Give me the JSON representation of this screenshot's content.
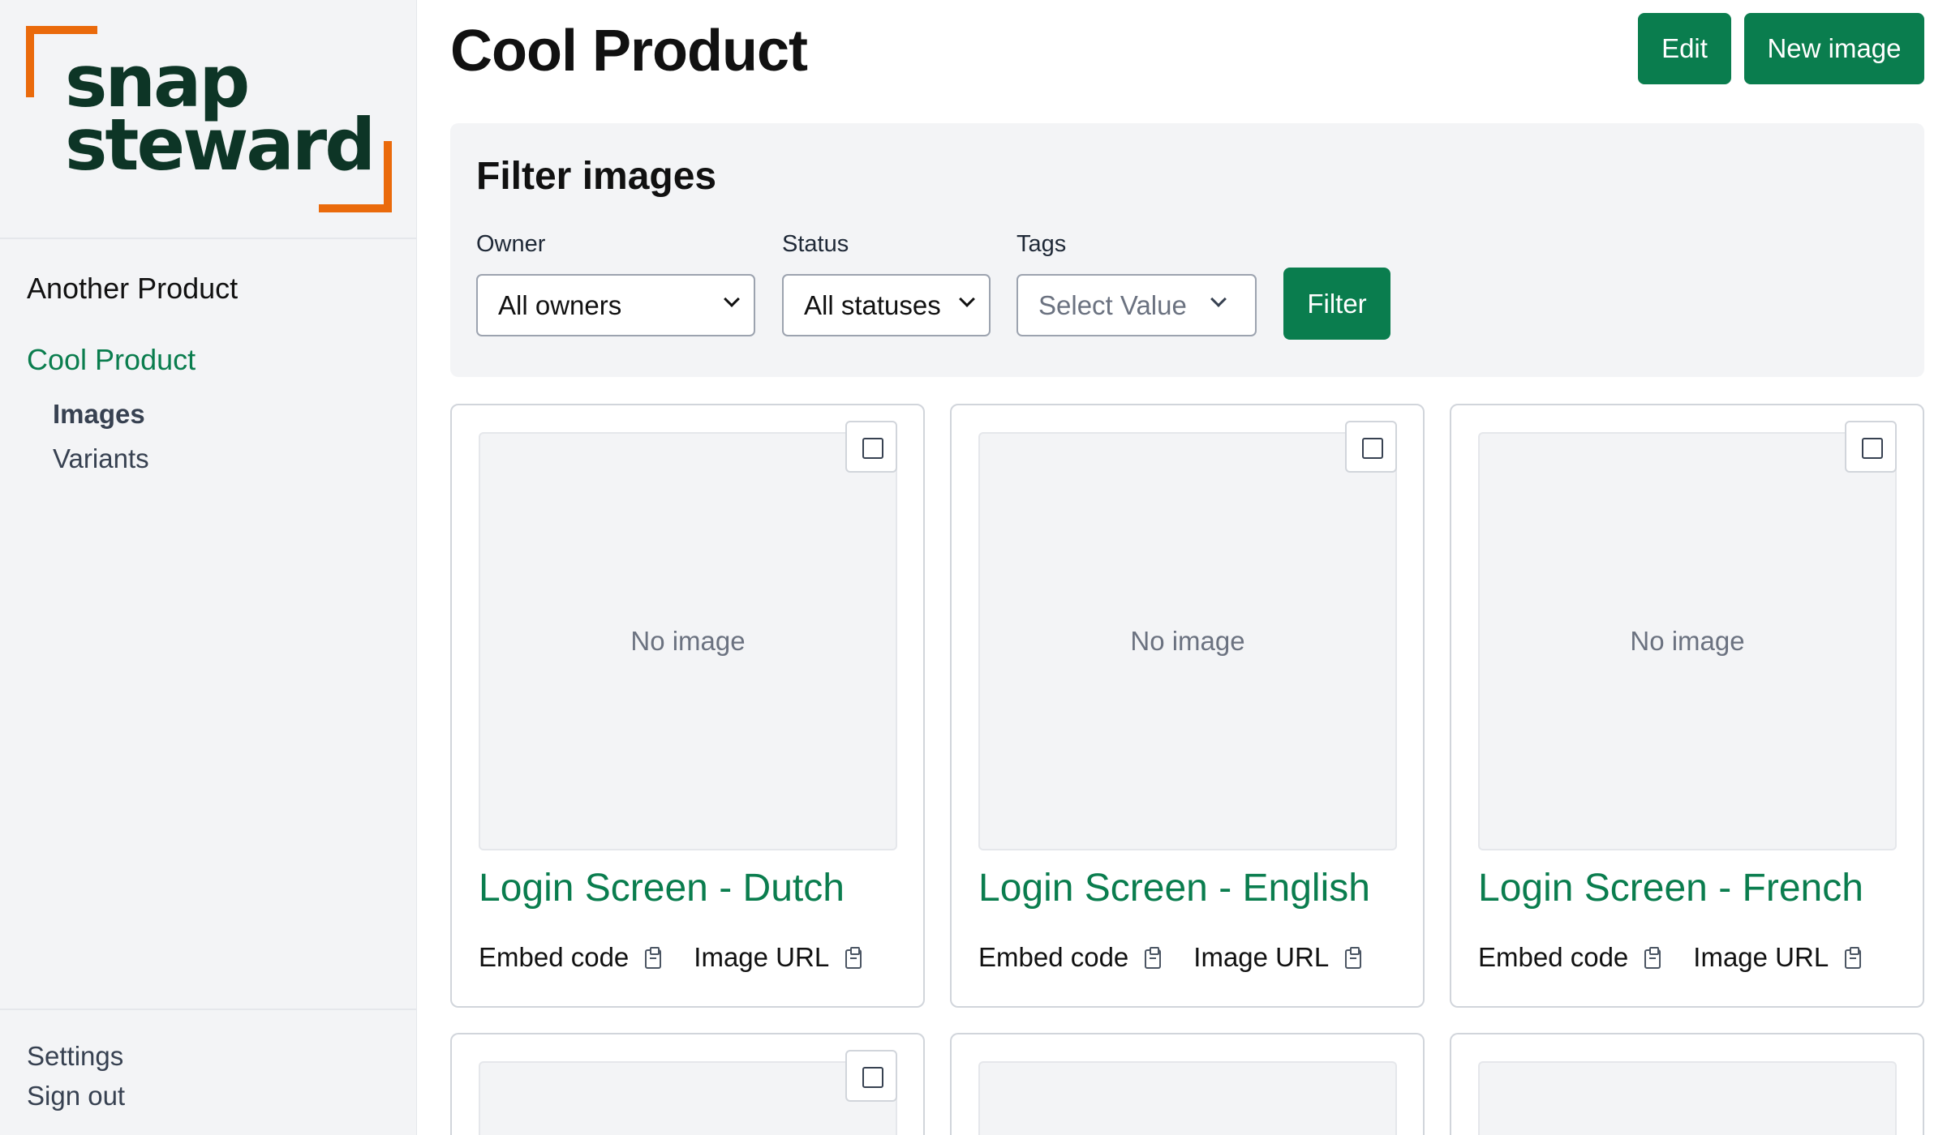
{
  "brand": {
    "line1": "snap",
    "line2": "steward",
    "accent_color": "#ea6a0b",
    "text_color": "#0d3526"
  },
  "sidebar": {
    "products": [
      {
        "label": "Another Product"
      },
      {
        "label": "Cool Product",
        "active": true
      }
    ],
    "subnav": [
      {
        "label": "Images",
        "active": true
      },
      {
        "label": "Variants"
      }
    ],
    "bottom": {
      "settings": "Settings",
      "sign_out": "Sign out"
    }
  },
  "header": {
    "title": "Cool Product",
    "edit_label": "Edit",
    "new_image_label": "New image"
  },
  "filter": {
    "title": "Filter images",
    "owner": {
      "label": "Owner",
      "value": "All owners"
    },
    "status": {
      "label": "Status",
      "value": "All statuses"
    },
    "tags": {
      "label": "Tags",
      "placeholder": "Select Value"
    },
    "button_label": "Filter"
  },
  "cards": [
    {
      "title": "Login Screen - Dutch",
      "placeholder": "No image",
      "embed_label": "Embed code",
      "url_label": "Image URL"
    },
    {
      "title": "Login Screen - English",
      "placeholder": "No image",
      "embed_label": "Embed code",
      "url_label": "Image URL"
    },
    {
      "title": "Login Screen - French",
      "placeholder": "No image",
      "embed_label": "Embed code",
      "url_label": "Image URL"
    }
  ],
  "colors": {
    "primary": "#0a7d4e",
    "panel_bg": "#f3f4f6"
  }
}
